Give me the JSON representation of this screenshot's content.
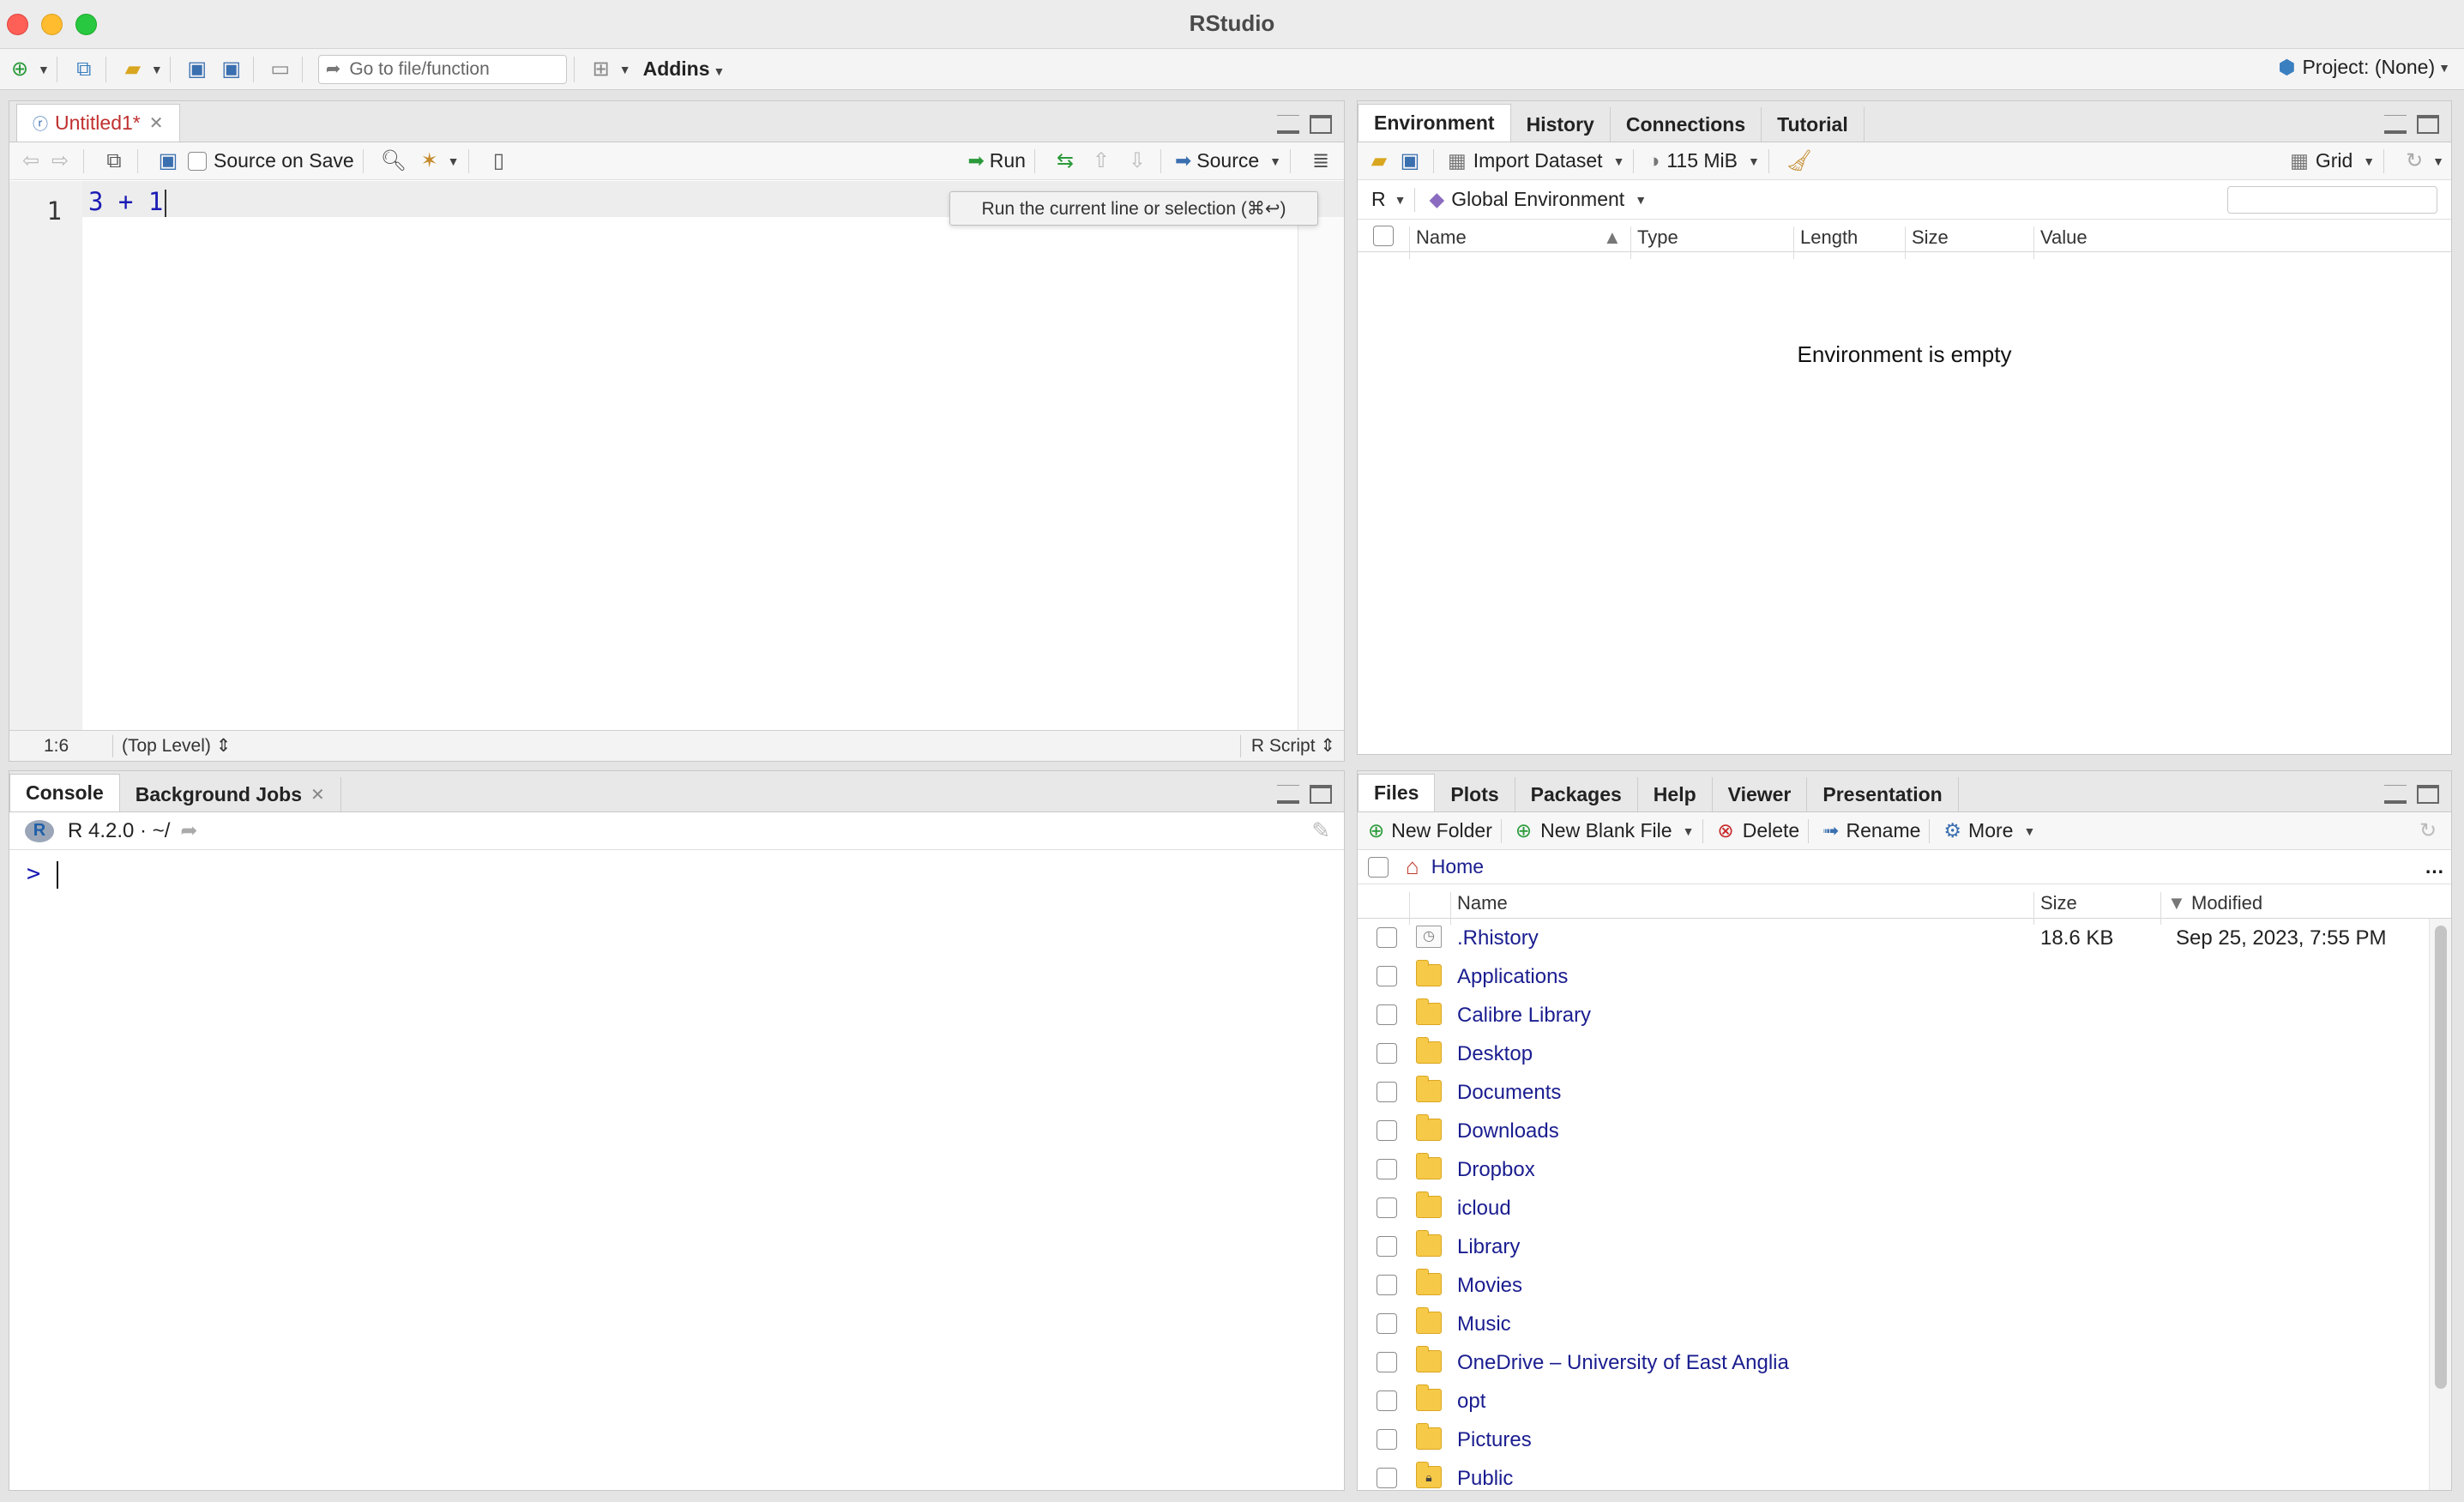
{
  "window": {
    "title": "RStudio"
  },
  "toolbar": {
    "goto_placeholder": "Go to file/function",
    "addins_label": "Addins",
    "project_label": "Project: (None)"
  },
  "source": {
    "tab_label": "Untitled1*",
    "source_on_save_label": "Source on Save",
    "run_label": "Run",
    "source_label": "Source",
    "tooltip": "Run the current line or selection (⌘↩)",
    "line_number": "1",
    "code": "3 + 1",
    "status_position": "1:6",
    "status_scope": "(Top Level) ⇕",
    "status_filetype": "R Script ⇕"
  },
  "console": {
    "tabs": [
      "Console",
      "Background Jobs"
    ],
    "version": "R 4.2.0 · ~/",
    "prompt": ">"
  },
  "environment": {
    "tabs": [
      "Environment",
      "History",
      "Connections",
      "Tutorial"
    ],
    "import_dataset_label": "Import Dataset",
    "memory_label": "115 MiB",
    "grid_label": "Grid",
    "lang_label": "R",
    "scope_label": "Global Environment",
    "columns": [
      "Name",
      "Type",
      "Length",
      "Size",
      "Value"
    ],
    "empty_message": "Environment is empty"
  },
  "files": {
    "tabs": [
      "Files",
      "Plots",
      "Packages",
      "Help",
      "Viewer",
      "Presentation"
    ],
    "new_folder_label": "New Folder",
    "new_blank_file_label": "New Blank File",
    "delete_label": "Delete",
    "rename_label": "Rename",
    "more_label": "More",
    "breadcrumb_home": "Home",
    "columns": {
      "name": "Name",
      "size": "Size",
      "modified": "Modified"
    },
    "rows": [
      {
        "name": ".Rhistory",
        "size": "18.6 KB",
        "modified": "Sep 25, 2023, 7:55 PM",
        "kind": "file"
      },
      {
        "name": "Applications",
        "size": "",
        "modified": "",
        "kind": "folder"
      },
      {
        "name": "Calibre Library",
        "size": "",
        "modified": "",
        "kind": "folder"
      },
      {
        "name": "Desktop",
        "size": "",
        "modified": "",
        "kind": "folder"
      },
      {
        "name": "Documents",
        "size": "",
        "modified": "",
        "kind": "folder"
      },
      {
        "name": "Downloads",
        "size": "",
        "modified": "",
        "kind": "folder"
      },
      {
        "name": "Dropbox",
        "size": "",
        "modified": "",
        "kind": "folder"
      },
      {
        "name": "icloud",
        "size": "",
        "modified": "",
        "kind": "folder"
      },
      {
        "name": "Library",
        "size": "",
        "modified": "",
        "kind": "folder"
      },
      {
        "name": "Movies",
        "size": "",
        "modified": "",
        "kind": "folder"
      },
      {
        "name": "Music",
        "size": "",
        "modified": "",
        "kind": "folder"
      },
      {
        "name": "OneDrive – University of East Anglia",
        "size": "",
        "modified": "",
        "kind": "folder"
      },
      {
        "name": "opt",
        "size": "",
        "modified": "",
        "kind": "folder"
      },
      {
        "name": "Pictures",
        "size": "",
        "modified": "",
        "kind": "folder"
      },
      {
        "name": "Public",
        "size": "",
        "modified": "",
        "kind": "locked-folder"
      }
    ]
  }
}
